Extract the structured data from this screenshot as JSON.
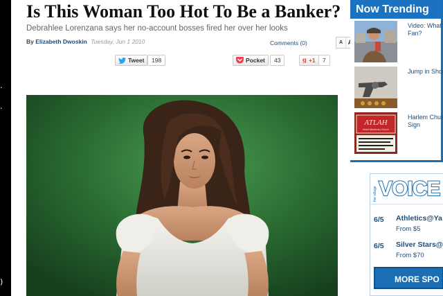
{
  "article": {
    "headline": "Is This Woman Too Hot To Be a Banker?",
    "dek": "Debrahlee Lorenzana says her no-account bosses fired her over her looks",
    "byline_prefix": "By",
    "author": "Elizabeth Dwoskin",
    "date": "Tuesday, Jun 1 2010",
    "comments": "Comments (0)",
    "text_sizes": [
      "A",
      "A",
      "A"
    ]
  },
  "social": {
    "tweet_label": "Tweet",
    "tweet_count": "198",
    "pocket_label": "Pocket",
    "pocket_count": "43",
    "gplus_label": "+1",
    "gplus_count": "7"
  },
  "trending": {
    "header": "Now Trending",
    "items": [
      {
        "label": "Video: What's",
        "label2": "Fan?"
      },
      {
        "label": "Jump in Shoo",
        "label2": ""
      },
      {
        "label": "Harlem Churc",
        "label2": "Sign"
      }
    ],
    "sign_text": "ATLAH",
    "sign_sub": "World Missionary Church"
  },
  "voice": {
    "logo_small": "the village",
    "logo": "VOICE",
    "events": [
      {
        "date": "6/5",
        "name": "Athletics@Ya",
        "price": "From $5"
      },
      {
        "date": "6/5",
        "name": "Silver Stars@",
        "price": "From $70"
      }
    ],
    "more_label": "MORE SPO"
  },
  "colors": {
    "trend_blue": "#1a72c0",
    "link_blue": "#1b4d80",
    "photo_green": "#2a6a32"
  }
}
